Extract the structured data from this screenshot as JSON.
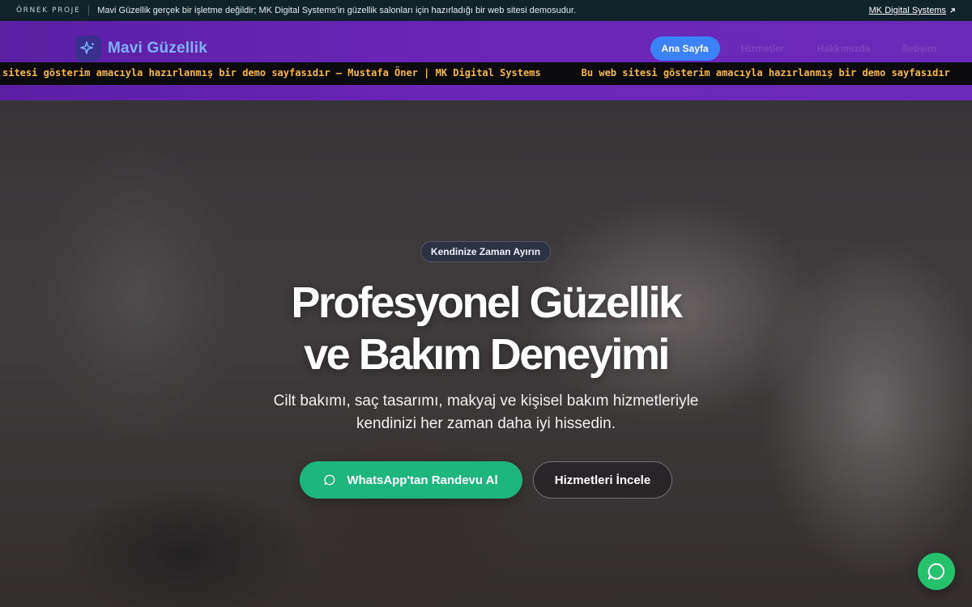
{
  "notice": {
    "tag": "ÖRNEK PROJE",
    "text": "Mavi Güzellik gerçek bir işletme değildir; MK Digital Systems'in güzellik salonları için hazırladığı bir web sitesi demosudur.",
    "link_label": "MK Digital Systems",
    "link_icon": "external-link-icon"
  },
  "header": {
    "brand_name": "Mavi Güzellik",
    "brand_icon": "sparkles-icon",
    "nav": [
      {
        "label": "Ana Sayfa",
        "active": true
      },
      {
        "label": "Hizmetler",
        "active": false
      },
      {
        "label": "Hakkımızda",
        "active": false
      },
      {
        "label": "İletişim",
        "active": false
      }
    ],
    "ticker_a": "sitesi gösterim amacıyla hazırlanmış bir demo sayfasıdır — Mustafa Öner | MK Digital Systems",
    "ticker_b": "Bu web sitesi gösterim amacıyla hazırlanmış bir demo sayfasıdır"
  },
  "hero": {
    "kicker": "Kendinize Zaman Ayırın",
    "title_line1": "Profesyonel Güzellik",
    "title_line2": "ve Bakım Deneyimi",
    "subtitle_line1": "Cilt bakımı, saç tasarımı, makyaj ve kişisel bakım hizmetleriyle",
    "subtitle_line2": "kendinizi her zaman daha iyi hissedin.",
    "primary_button": "WhatsApp'tan Randevu Al",
    "secondary_button": "Hizmetleri İncele"
  },
  "colors": {
    "accent_blue": "#3b82f6",
    "whatsapp_green": "#1fb57f",
    "header_purple": "#6a25b8",
    "ticker_text": "#f5b74a"
  }
}
